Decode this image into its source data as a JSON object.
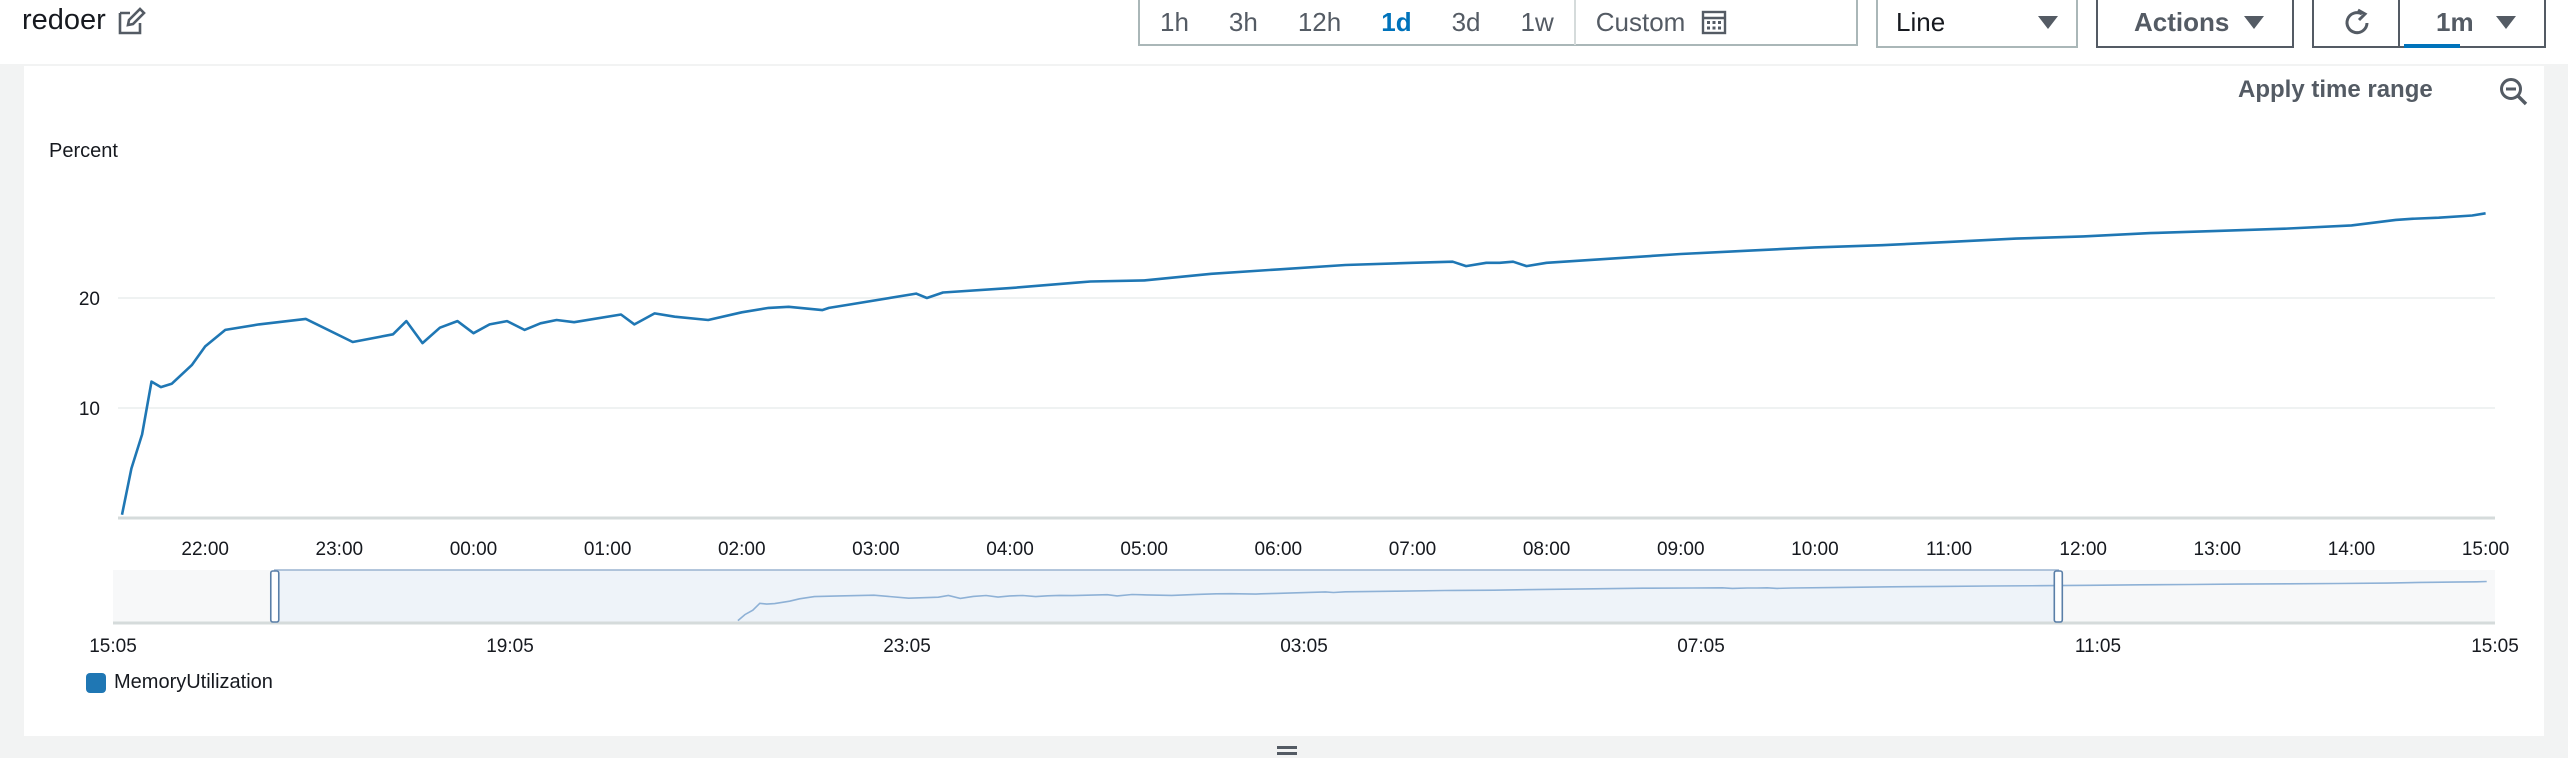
{
  "widget": {
    "title": "redoer"
  },
  "toolbar": {
    "ranges": [
      "1h",
      "3h",
      "12h",
      "1d",
      "3d",
      "1w"
    ],
    "active_range": "1d",
    "custom_label": "Custom",
    "view_type": "Line",
    "actions_label": "Actions",
    "refresh_interval": "1m"
  },
  "chart_controls": {
    "apply_time_range": "Apply time range"
  },
  "chart_data": {
    "type": "line",
    "title": "",
    "ylabel": "Percent",
    "ylim": [
      0,
      33
    ],
    "yticks": [
      10,
      20
    ],
    "x_ticks": [
      "22:00",
      "23:00",
      "00:00",
      "01:00",
      "02:00",
      "03:00",
      "04:00",
      "05:00",
      "06:00",
      "07:00",
      "08:00",
      "09:00",
      "10:00",
      "11:00",
      "12:00",
      "13:00",
      "14:00",
      "15:00"
    ],
    "x_range_hours": [
      -0.65,
      17.07
    ],
    "series": [
      {
        "name": "MemoryUtilization",
        "color": "#1f77b4",
        "x": [
          -0.62,
          -0.55,
          -0.47,
          -0.4,
          -0.33,
          -0.25,
          -0.1,
          0.0,
          0.15,
          0.4,
          0.75,
          1.1,
          1.4,
          1.5,
          1.62,
          1.75,
          1.88,
          2.0,
          2.12,
          2.25,
          2.38,
          2.5,
          2.62,
          2.75,
          3.1,
          3.2,
          3.35,
          3.5,
          3.75,
          4.0,
          4.2,
          4.35,
          4.6,
          4.65,
          4.8,
          5.3,
          5.38,
          5.5,
          6.0,
          6.5,
          6.6,
          7.0,
          7.5,
          8.0,
          8.5,
          9.0,
          9.3,
          9.4,
          9.55,
          9.65,
          9.75,
          9.85,
          10.0,
          10.5,
          11.0,
          11.5,
          12.0,
          12.5,
          13.0,
          13.5,
          14.0,
          14.5,
          15.0,
          15.5,
          16.0,
          16.33,
          16.45,
          16.65,
          16.9,
          17.0
        ],
        "y": [
          0.3,
          4.5,
          7.6,
          12.4,
          11.9,
          12.2,
          13.9,
          15.6,
          17.1,
          17.6,
          18.1,
          16.0,
          16.7,
          17.9,
          15.9,
          17.3,
          17.9,
          16.8,
          17.6,
          17.9,
          17.1,
          17.7,
          18.0,
          17.8,
          18.5,
          17.6,
          18.6,
          18.3,
          18.0,
          18.7,
          19.1,
          19.2,
          18.9,
          19.1,
          19.4,
          20.4,
          20.0,
          20.5,
          20.9,
          21.4,
          21.5,
          21.6,
          22.2,
          22.6,
          23.0,
          23.2,
          23.3,
          22.9,
          23.2,
          23.2,
          23.3,
          22.9,
          23.2,
          23.6,
          24.0,
          24.3,
          24.6,
          24.8,
          25.1,
          25.4,
          25.6,
          25.9,
          26.1,
          26.3,
          26.6,
          27.1,
          27.2,
          27.3,
          27.5,
          27.7
        ]
      }
    ]
  },
  "overview": {
    "ticks": [
      "15:05",
      "19:05",
      "23:05",
      "03:05",
      "07:05",
      "11:05",
      "15:05"
    ],
    "selection_start_hours": 1.63,
    "selection_end_hours": 19.6
  }
}
